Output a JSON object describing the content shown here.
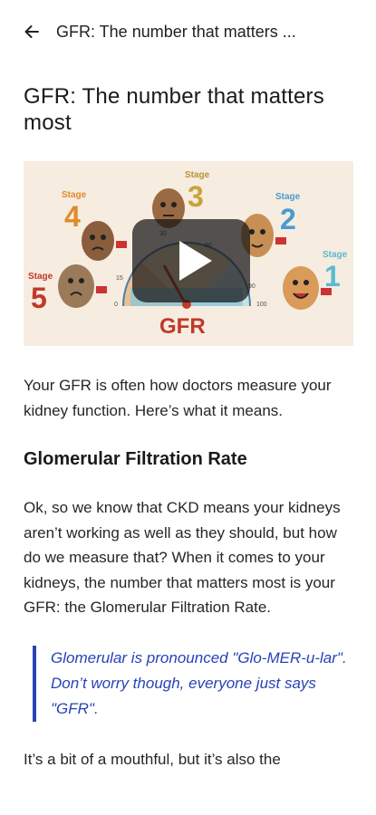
{
  "topbar": {
    "title": "GFR: The number that matters ..."
  },
  "article": {
    "title": "GFR: The number that matters most",
    "lead": "Your GFR is often how doctors measure your kidney function. Here’s what it means.",
    "section_heading": "Glomerular Filtration Rate",
    "paragraph1": "Ok, so we know that CKD means your kidneys aren’t working as well as they should, but how do we measure that? When it comes to your kidneys, the number that matters most is your GFR: the Glomerular Filtration Rate.",
    "quote": "Glomerular is pronounced \"Glo-MER-u-lar\". Don’t worry though, everyone just says \"GFR\".",
    "tail": "It’s a bit of a mouthful, but it’s also the"
  },
  "video": {
    "stage_word": "Stage",
    "stage_labels": [
      "5",
      "4",
      "3",
      "2",
      "1"
    ],
    "gauge_label": "GFR",
    "gauge_ticks": [
      "0",
      "15",
      "30",
      "60",
      "90",
      "100"
    ],
    "colors": {
      "stage5": "#c0392b",
      "stage4": "#e08a2c",
      "stage3": "#c9a23a",
      "stage2": "#4a9ad0",
      "stage1": "#5bbad3",
      "gfr": "#c0392b"
    }
  }
}
